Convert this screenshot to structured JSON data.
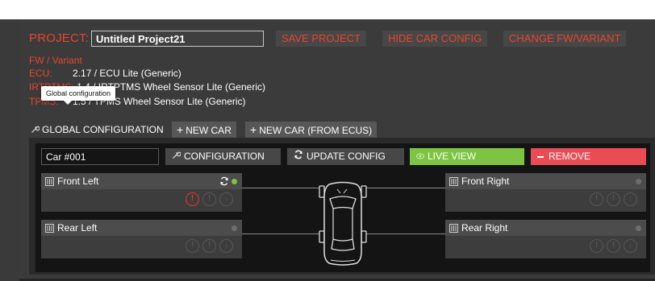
{
  "header": {
    "project_label": "PROJECT:",
    "project_name": "Untitled Project21",
    "buttons": [
      "SAVE PROJECT",
      "HIDE CAR CONFIG",
      "CHANGE FW/VARIANT"
    ]
  },
  "fw": {
    "title": "FW / Variant",
    "rows": [
      {
        "key": "ECU:",
        "value": "2.17 / ECU Lite (Generic)"
      },
      {
        "key": "IRTPTMS:",
        "value": "1.4 / IRTPTMS Wheel Sensor Lite (Generic)"
      },
      {
        "key": "TPMS:",
        "value": "1.5 / TPMS Wheel Sensor Lite (Generic)"
      }
    ]
  },
  "tooltip": "Global configuration",
  "tabs": [
    {
      "label": "GLOBAL CONFIGURATION",
      "icon": "wrench-icon"
    },
    {
      "label": "NEW CAR",
      "icon": "plus-icon"
    },
    {
      "label": "NEW CAR (FROM ECUS)",
      "icon": "plus-icon"
    }
  ],
  "car": {
    "name": "Car #001",
    "config_label": "CONFIGURATION",
    "update_label": "UPDATE CONFIG",
    "live_label": "LIVE VIEW",
    "remove_label": "REMOVE"
  },
  "wheels": [
    {
      "name": "Front Left",
      "status_color": "#7cc442",
      "syncing": true,
      "alert": true
    },
    {
      "name": "Front Right",
      "status_color": "#6e6e6e",
      "syncing": false,
      "alert": false
    },
    {
      "name": "Rear Left",
      "status_color": "#6e6e6e",
      "syncing": false,
      "alert": false
    },
    {
      "name": "Rear Right",
      "status_color": "#6e6e6e",
      "syncing": false,
      "alert": false
    }
  ],
  "colors": {
    "accent": "#e8452c",
    "live": "#7cc442",
    "remove": "#ea4c55",
    "alert": "#f03030"
  }
}
